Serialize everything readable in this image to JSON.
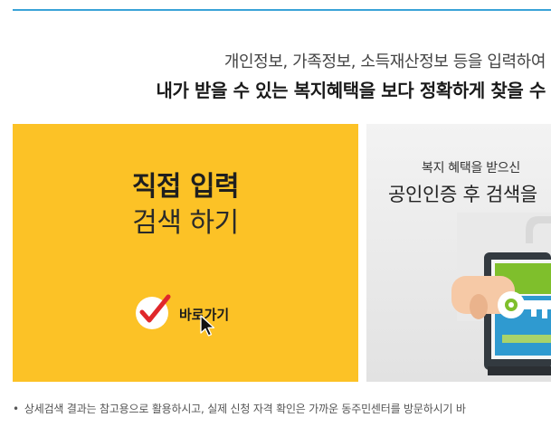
{
  "intro": {
    "line1": "개인정보, 가족정보, 소득재산정보 등을 입력하여",
    "line2": "내가 받을 수 있는 복지혜택을 보다 정확하게 찾을 수"
  },
  "direct_panel": {
    "title_strong": "직접 입력",
    "title_light": "검색 하기",
    "shortcut_label": "바로가기",
    "background_color": "#fcc226"
  },
  "cert_panel": {
    "line1": "복지 혜택을 받으신",
    "line2": "공인인증 후 검색을"
  },
  "footnote": {
    "bullet": "•",
    "text": "상세검색 결과는 참고용으로 활용하시고, 실제 신청 자격 확인은 가까운 동주민센터를 방문하시기 바"
  },
  "icons": {
    "check": "check-circle-icon",
    "cursor": "mouse-pointer-icon",
    "certificate": "certificate-key-illustration"
  },
  "colors": {
    "accent_line": "#3aa3d8",
    "check_red": "#e0272b"
  }
}
